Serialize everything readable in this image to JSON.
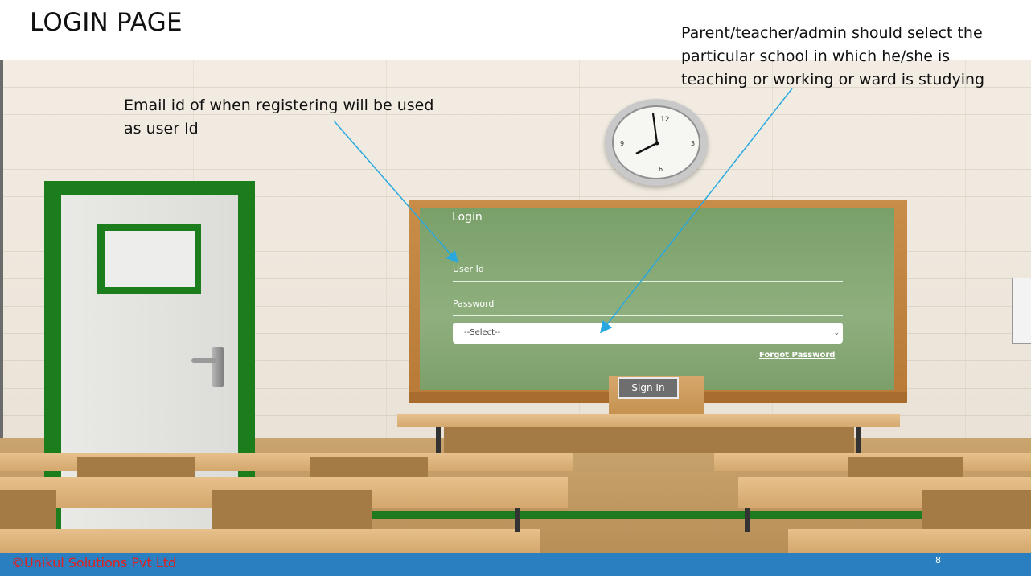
{
  "slide": {
    "title": "LOGIN PAGE",
    "page_number": "8",
    "copyright": "©Unikul Solutions Pvt Ltd"
  },
  "annotations": {
    "user_id_note_line1": "Email id of when registering will be used",
    "user_id_note_line2": "as user Id",
    "school_note_line1": "Parent/teacher/admin should select the",
    "school_note_line2": "particular school in which he/she is",
    "school_note_line3": "teaching or working or ward is studying"
  },
  "login_form": {
    "title": "Login",
    "user_id_label": "User Id",
    "password_label": "Password",
    "school_select_value": "--Select--",
    "forgot_password": "Forgot Password",
    "sign_in": "Sign In"
  },
  "clock": {
    "numerals": [
      "12",
      "3",
      "6",
      "9"
    ]
  },
  "colors": {
    "board": "#8fb07e",
    "footer": "#2a7fc0",
    "copyright": "#e02020",
    "arrow": "#29a8df"
  }
}
